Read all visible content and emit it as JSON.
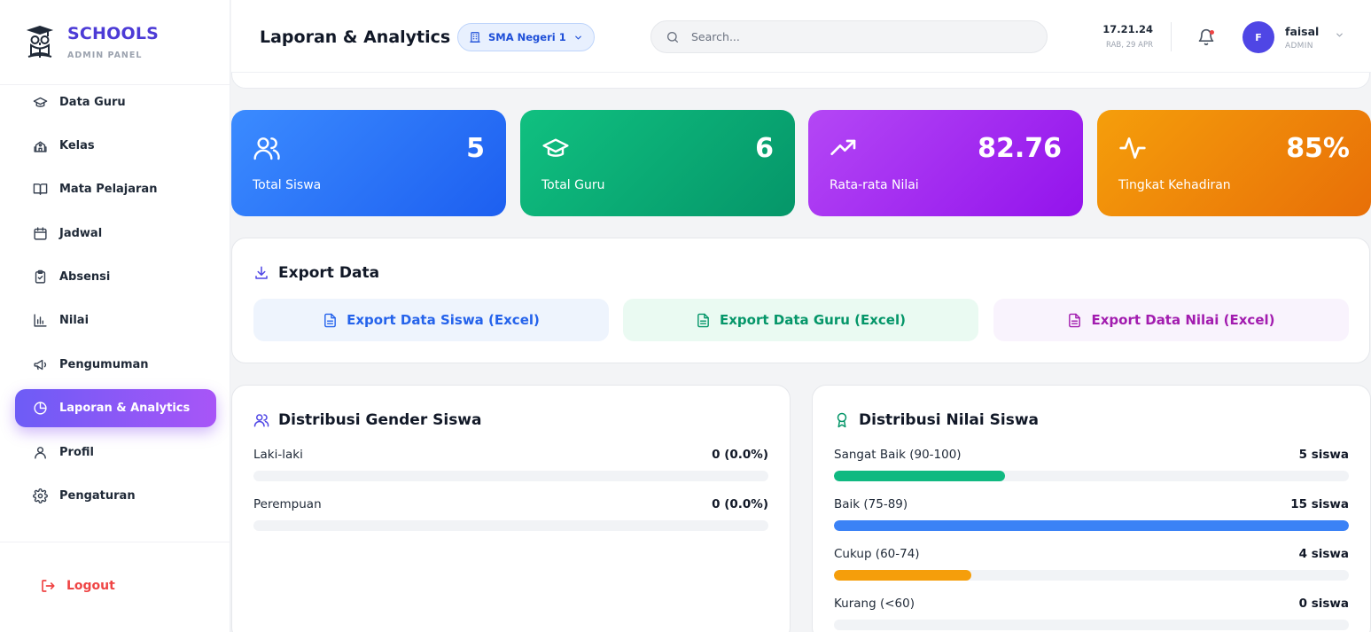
{
  "brand": {
    "title": "SCHOOLS",
    "subtitle": "ADMIN PANEL"
  },
  "sidebar": {
    "items": [
      {
        "label": "Data Guru",
        "icon": "graduation-cap-icon",
        "active": false
      },
      {
        "label": "Kelas",
        "icon": "school-building-icon",
        "active": false
      },
      {
        "label": "Mata Pelajaran",
        "icon": "book-open-icon",
        "active": false
      },
      {
        "label": "Jadwal",
        "icon": "calendar-icon",
        "active": false
      },
      {
        "label": "Absensi",
        "icon": "clipboard-check-icon",
        "active": false
      },
      {
        "label": "Nilai",
        "icon": "bar-chart-icon",
        "active": false
      },
      {
        "label": "Pengumuman",
        "icon": "megaphone-icon",
        "active": false
      },
      {
        "label": "Laporan & Analytics",
        "icon": "pie-chart-icon",
        "active": true
      },
      {
        "label": "Profil",
        "icon": "user-icon",
        "active": false
      },
      {
        "label": "Pengaturan",
        "icon": "gear-icon",
        "active": false
      }
    ],
    "logout_label": "Logout"
  },
  "header": {
    "title": "Laporan & Analytics",
    "school_selected": "SMA Negeri 1",
    "search_placeholder": "Search...",
    "time": "17.21.24",
    "date": "RAB, 29 APR",
    "user": {
      "initial": "F",
      "name": "faisal",
      "role": "ADMIN"
    }
  },
  "stats": [
    {
      "value": "5",
      "label": "Total Siswa",
      "icon": "users-icon"
    },
    {
      "value": "6",
      "label": "Total Guru",
      "icon": "graduation-cap-icon"
    },
    {
      "value": "82.76",
      "label": "Rata-rata Nilai",
      "icon": "trending-up-icon"
    },
    {
      "value": "85%",
      "label": "Tingkat Kehadiran",
      "icon": "activity-icon"
    }
  ],
  "export": {
    "title": "Export Data",
    "buttons": [
      {
        "label": "Export Data Siswa (Excel)",
        "color": "#2563eb"
      },
      {
        "label": "Export Data Guru (Excel)",
        "color": "#059669"
      },
      {
        "label": "Export Data Nilai (Excel)",
        "color": "#a21caf"
      }
    ]
  },
  "gender": {
    "title": "Distribusi Gender Siswa",
    "rows": [
      {
        "label": "Laki-laki",
        "value": "0 (0.0%)",
        "fraction": 0
      },
      {
        "label": "Perempuan",
        "value": "0 (0.0%)",
        "fraction": 0
      }
    ]
  },
  "nilai": {
    "title": "Distribusi Nilai Siswa",
    "rows": [
      {
        "label": "Sangat Baik (90-100)",
        "value": "5 siswa",
        "fraction": 0.333,
        "color": "#10b981"
      },
      {
        "label": "Baik (75-89)",
        "value": "15 siswa",
        "fraction": 1.0,
        "color": "#3b82f6"
      },
      {
        "label": "Cukup (60-74)",
        "value": "4 siswa",
        "fraction": 0.267,
        "color": "#f59e0b"
      },
      {
        "label": "Kurang (<60)",
        "value": "0 siswa",
        "fraction": 0,
        "color": "#ef4444"
      }
    ]
  }
}
